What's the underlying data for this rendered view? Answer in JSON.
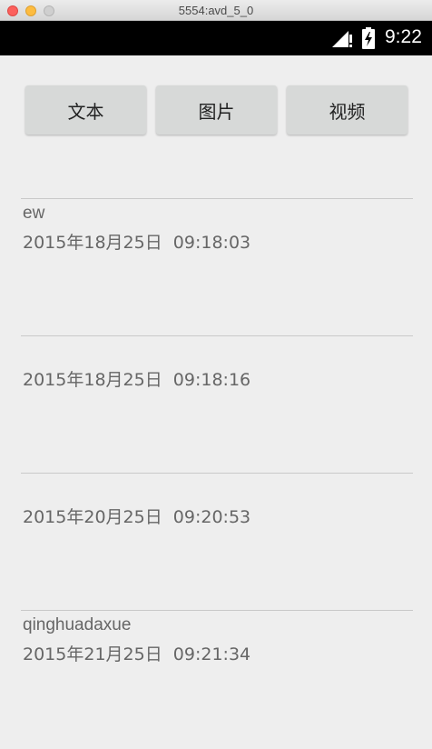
{
  "window": {
    "title": "5554:avd_5_0"
  },
  "status_bar": {
    "time": "9:22",
    "icons": [
      "signal-icon",
      "battery-charging-icon"
    ]
  },
  "toolbar": {
    "text_label": "文本",
    "image_label": "图片",
    "video_label": "视频"
  },
  "notes": [
    {
      "title": "ew",
      "time": "2015年18月25日  09:18:03"
    },
    {
      "title": "",
      "time": "2015年18月25日  09:18:16"
    },
    {
      "title": "",
      "time": "2015年20月25日  09:20:53"
    },
    {
      "title": "qinghuadaxue",
      "time": "2015年21月25日  09:21:34"
    }
  ],
  "colors": {
    "background": "#eeeeee",
    "button": "#d7d9d8",
    "status_bar": "#000000",
    "list_text": "#666666",
    "divider": "#c9c9c9"
  }
}
